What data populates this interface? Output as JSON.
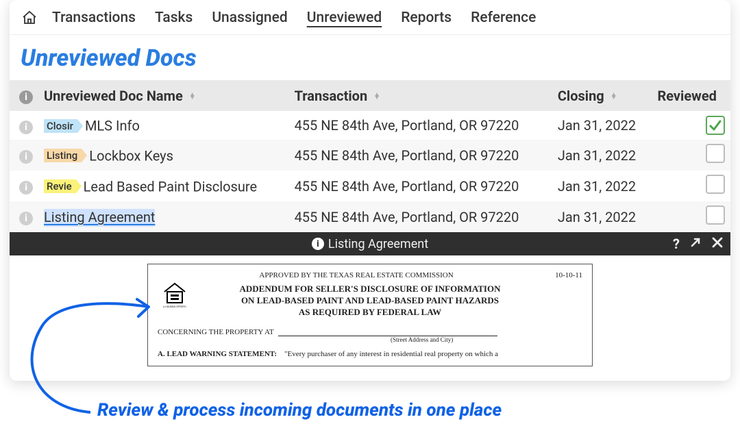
{
  "nav": {
    "items": [
      "Transactions",
      "Tasks",
      "Unassigned",
      "Unreviewed",
      "Reports",
      "Reference"
    ],
    "activeIndex": 3
  },
  "page_title": "Unreviewed Docs",
  "table": {
    "headers": {
      "name": "Unreviewed Doc Name",
      "transaction": "Transaction",
      "closing": "Closing",
      "reviewed": "Reviewed"
    },
    "rows": [
      {
        "tag": "Closir",
        "tagColor": "blue",
        "name": "MLS Info",
        "transaction": "455 NE 84th Ave, Portland, OR 97220",
        "closing": "Jan 31, 2022",
        "reviewed": true,
        "selected": false
      },
      {
        "tag": "Listing",
        "tagColor": "orange",
        "name": "Lockbox Keys",
        "transaction": "455 NE 84th Ave, Portland, OR 97220",
        "closing": "Jan 31, 2022",
        "reviewed": false,
        "selected": false
      },
      {
        "tag": "Revie",
        "tagColor": "yellow",
        "name": "Lead Based Paint Disclosure",
        "transaction": "455 NE 84th Ave, Portland, OR 97220",
        "closing": "Jan 31, 2022",
        "reviewed": false,
        "selected": false
      },
      {
        "tag": "",
        "tagColor": "",
        "name": "Listing Agreement",
        "transaction": "455 NE 84th Ave, Portland, OR 97220",
        "closing": "Jan 31, 2022",
        "reviewed": false,
        "selected": true
      }
    ]
  },
  "preview": {
    "title": "Listing Agreement",
    "approved": "APPROVED BY THE TEXAS REAL ESTATE COMMISSION",
    "date_code": "10-10-11",
    "heading1": "ADDENDUM FOR SELLER'S DISCLOSURE OF INFORMATION",
    "heading2": "ON LEAD-BASED PAINT AND LEAD-BASED PAINT HAZARDS",
    "heading3": "AS REQUIRED BY FEDERAL LAW",
    "concerning": "CONCERNING THE PROPERTY AT",
    "street_hint": "(Street Address and City)",
    "warning_label": "A. LEAD WARNING STATEMENT:",
    "warning_text": "\"Every purchaser of any interest in residential real property on which a",
    "logo_caption": "EQUAL HOUSING OPPORTUNITY"
  },
  "callout": "Review & process incoming documents in one place"
}
